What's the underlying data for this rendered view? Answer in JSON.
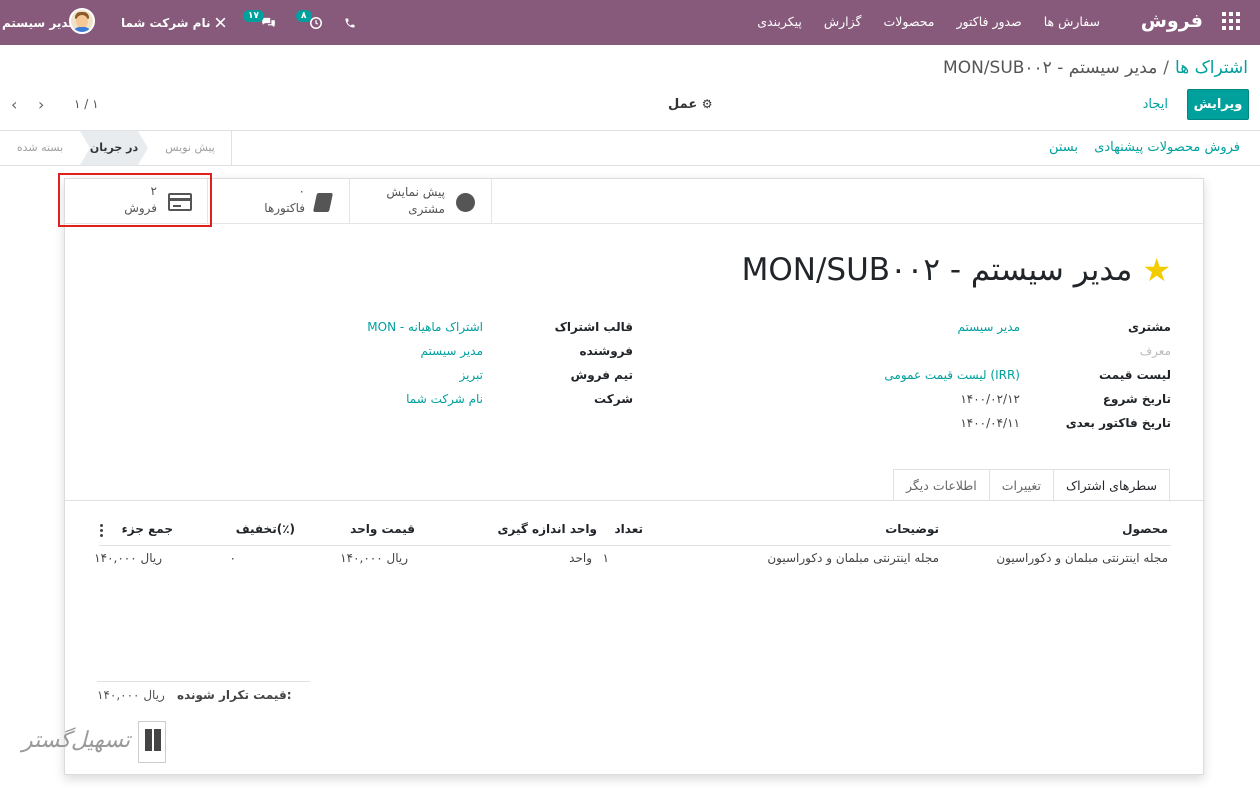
{
  "navbar": {
    "brand": "فروش",
    "menu": [
      "سفارش ها",
      "صدور فاکتور",
      "محصولات",
      "گزارش",
      "پیکربندی"
    ],
    "activity_count": "۸",
    "message_count": "۱۷",
    "company": "نام شرکت شما",
    "user": "مدیر سیستم",
    "colors": {
      "bar": "#875a7b",
      "accent": "#00a09d"
    }
  },
  "control": {
    "breadcrumb_parent": "اشتراک ها",
    "breadcrumb_sep": "/",
    "breadcrumb_current": "MON/SUB۰۰۲ - مدیر سیستم",
    "edit_label": "ویرایش",
    "create_label": "ایجاد",
    "action_label": "عمل",
    "pager": "۱ / ۱"
  },
  "header": {
    "btn_upsell": "فروش محصولات پیشنهادی",
    "btn_close": "بستن",
    "stages": [
      "بسته شده",
      "در جریان",
      "پیش نویس"
    ],
    "active_stage": "در جریان"
  },
  "smart_buttons": {
    "portal_line1": "پیش نمایش",
    "portal_line2": "مشتری",
    "invoices_count": "۰",
    "invoices_label": "فاکتورها",
    "sales_count": "۲",
    "sales_label": "فروش"
  },
  "record": {
    "title": "MON/SUB۰۰۲ - مدیر سیستم",
    "left": [
      {
        "label": "مشتری",
        "value": "مدیر سیستم"
      },
      {
        "label": "معرف",
        "value": ""
      },
      {
        "label": "لیست قیمت",
        "value": "لیست قیمت عمومی (IRR)"
      },
      {
        "label": "تاریخ شروع",
        "value": "۱۴۰۰/۰۲/۱۲"
      },
      {
        "label": "تاریخ فاکتور بعدی",
        "value": "۱۴۰۰/۰۴/۱۱"
      }
    ],
    "right": [
      {
        "label": "قالب اشتراک",
        "value": "MON - اشتراک ماهیانه"
      },
      {
        "label": "فروشنده",
        "value": "مدیر سیستم"
      },
      {
        "label": "تیم فروش",
        "value": "تبریز"
      },
      {
        "label": "شرکت",
        "value": "نام شرکت شما"
      }
    ]
  },
  "tabs": [
    "سطرهای اشتراک",
    "تغییرات",
    "اطلاعات دیگر"
  ],
  "lines": {
    "columns": [
      "محصول",
      "توضیحات",
      "تعداد",
      "واحد اندازه گیری",
      "قیمت واحد",
      "تخفیف(٪)",
      "جمع جزء"
    ],
    "rows": [
      {
        "product": "مجله اینترنتی مبلمان و دکوراسیون",
        "description": "مجله اینترنتی مبلمان و دکوراسیون",
        "qty": "۱",
        "uom": "واحد",
        "price": "۱۴۰,۰۰۰ ریال",
        "discount": "۰",
        "subtotal": "۱۴۰,۰۰۰ ریال"
      }
    ]
  },
  "totals": {
    "label": "قیمت تکرار شونده:",
    "value": "۱۴۰,۰۰۰ ریال"
  },
  "watermark": "تسهیل‌گستر"
}
